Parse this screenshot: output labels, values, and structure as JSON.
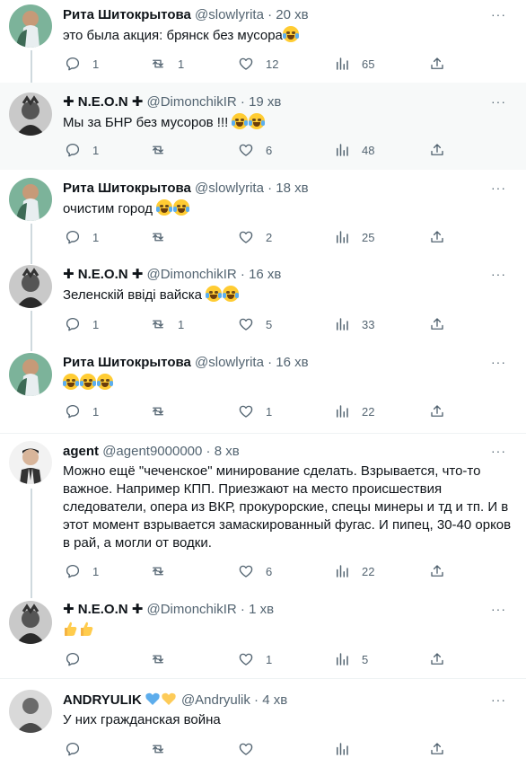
{
  "tweets": [
    {
      "name": "Рита Шитокрытова",
      "handle": "@slowlyrita",
      "dot": "·",
      "time": "20 хв",
      "text": "это была акция: брянск без мусора",
      "emojis": 1,
      "reply": "1",
      "retweet": "1",
      "like": "12",
      "views": "65"
    },
    {
      "name": "✚ N.E.O.N ✚",
      "handle": "@DimonchikIR",
      "dot": "·",
      "time": "19 хв",
      "text": "Мы за БНР без мусоров !!! ",
      "emojis": 2,
      "reply": "1",
      "retweet": "",
      "like": "6",
      "views": "48"
    },
    {
      "name": "Рита Шитокрытова",
      "handle": "@slowlyrita",
      "dot": "·",
      "time": "18 хв",
      "text": "очистим город ",
      "emojis": 2,
      "reply": "1",
      "retweet": "",
      "like": "2",
      "views": "25"
    },
    {
      "name": "✚ N.E.O.N ✚",
      "handle": "@DimonchikIR",
      "dot": "·",
      "time": "16 хв",
      "text": "Зеленскій ввіді вайска ",
      "emojis": 2,
      "reply": "1",
      "retweet": "1",
      "like": "5",
      "views": "33"
    },
    {
      "name": "Рита Шитокрытова",
      "handle": "@slowlyrita",
      "dot": "·",
      "time": "16 хв",
      "text": "",
      "emojis": 3,
      "reply": "1",
      "retweet": "",
      "like": "1",
      "views": "22"
    },
    {
      "name": "agent",
      "handle": "@agent9000000",
      "dot": "·",
      "time": "8 хв",
      "text": "Можно ещё \"чеченское\" минирование сделать. Взрывается, что-то важное. Например КПП. Приезжают на место происшествия следователи, опера из ВКР, прокурорские, спецы минеры и тд и тп. И в этот момент взрывается замаскированный фугас. И пипец, 30-40 орков в рай, а могли от водки.",
      "emojis": 0,
      "reply": "1",
      "retweet": "",
      "like": "6",
      "views": "22"
    },
    {
      "name": "✚ N.E.O.N ✚",
      "handle": "@DimonchikIR",
      "dot": "·",
      "time": "1 хв",
      "text": "",
      "emojis": 0,
      "thumbs": 2,
      "reply": "",
      "retweet": "",
      "like": "1",
      "views": "5"
    },
    {
      "name": "ANDRYULIK",
      "handle": "@Andryulik",
      "dot": "·",
      "time": "4 хв",
      "text": "У них гражданская война",
      "emojis": 0,
      "reply": "",
      "retweet": "",
      "like": "",
      "views": ""
    }
  ],
  "more_label": "···",
  "icons": [
    "reply-icon",
    "retweet-icon",
    "like-icon",
    "views-icon",
    "share-icon",
    "more-icon"
  ],
  "colors": {
    "text": "#0f1419",
    "secondary": "#536471",
    "thread_line": "#cfd9de",
    "highlight_bg": "#f7f9f9",
    "heart_blue": "#5dadec",
    "heart_yellow": "#fdcb58"
  }
}
